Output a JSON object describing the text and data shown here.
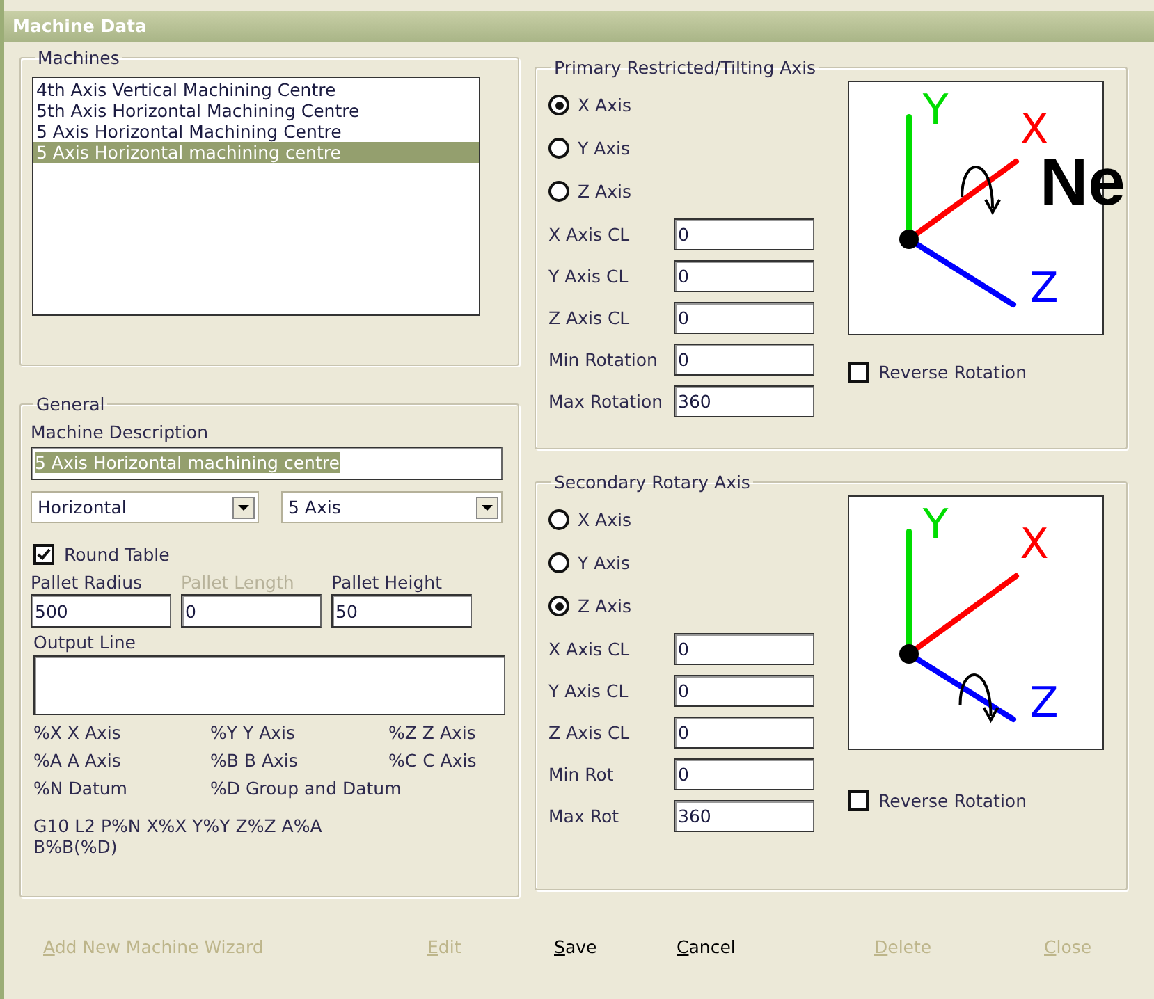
{
  "window": {
    "title": "Machine Data"
  },
  "machines": {
    "title": "Machines",
    "items": [
      {
        "label": "4th Axis Vertical Machining Centre",
        "selected": false
      },
      {
        "label": "5th Axis Horizontal Machining Centre",
        "selected": false
      },
      {
        "label": "5 Axis Horizontal Machining Centre",
        "selected": false
      },
      {
        "label": "5 Axis Horizontal machining centre",
        "selected": true
      }
    ]
  },
  "general": {
    "title": "General",
    "description_label": "Machine Description",
    "description_value": "5 Axis Horizontal machining centre",
    "description_selected": true,
    "dropdowns": [
      {
        "value": "Horizontal"
      },
      {
        "value": "5 Axis"
      }
    ],
    "round_table": {
      "label": "Round Table",
      "checked": true
    },
    "pallet_fields": [
      {
        "label": "Pallet Radius",
        "value": "500",
        "disabled": false
      },
      {
        "label": "Pallet Length",
        "value": "0",
        "disabled": true
      },
      {
        "label": "Pallet Height",
        "value": "50",
        "disabled": false
      }
    ],
    "output_line_label": "Output Line",
    "codes": [
      "%X X Axis",
      "%Y Y Axis",
      "%Z Z Axis",
      "%A A Axis",
      "%B B Axis",
      "%C C Axis",
      "%N Datum",
      "%D Group and Datum"
    ],
    "example": "G10 L2 P%N X%X Y%Y Z%Z A%A B%B(%D)"
  },
  "axis_groups": [
    {
      "title": "Primary Restricted/Tilting Axis",
      "axes": [
        {
          "label": "X Axis",
          "selected": true
        },
        {
          "label": "Y Axis",
          "selected": false
        },
        {
          "label": "Z Axis",
          "selected": false
        }
      ],
      "fields": [
        {
          "label": "X Axis CL",
          "value": "0"
        },
        {
          "label": "Y Axis CL",
          "value": "0"
        },
        {
          "label": "Z Axis CL",
          "value": "0"
        },
        {
          "label": "Min Rotation",
          "value": "0"
        },
        {
          "label": "Max Rotation",
          "value": "360"
        }
      ],
      "axis_labels": [
        "X",
        "Y",
        "Z"
      ],
      "reverse": {
        "label": "Reverse Rotation",
        "checked": false
      },
      "overlay_text": "Ne"
    },
    {
      "title": "Secondary Rotary Axis",
      "axes": [
        {
          "label": "X Axis",
          "selected": false
        },
        {
          "label": "Y Axis",
          "selected": false
        },
        {
          "label": "Z Axis",
          "selected": true
        }
      ],
      "fields": [
        {
          "label": "X Axis CL",
          "value": "0"
        },
        {
          "label": "Y Axis CL",
          "value": "0"
        },
        {
          "label": "Z Axis CL",
          "value": "0"
        },
        {
          "label": "Min Rot",
          "value": "0"
        },
        {
          "label": "Max Rot",
          "value": "360"
        }
      ],
      "axis_labels": [
        "X",
        "Y",
        "Z"
      ],
      "reverse": {
        "label": "Reverse Rotation",
        "checked": false
      }
    }
  ],
  "buttons": [
    {
      "label": "Add New Machine Wizard",
      "disabled": true
    },
    {
      "label": "Edit",
      "disabled": true
    },
    {
      "label": "Save",
      "disabled": false
    },
    {
      "label": "Cancel",
      "disabled": false
    },
    {
      "label": "Delete",
      "disabled": true
    },
    {
      "label": "Close",
      "disabled": true
    }
  ]
}
